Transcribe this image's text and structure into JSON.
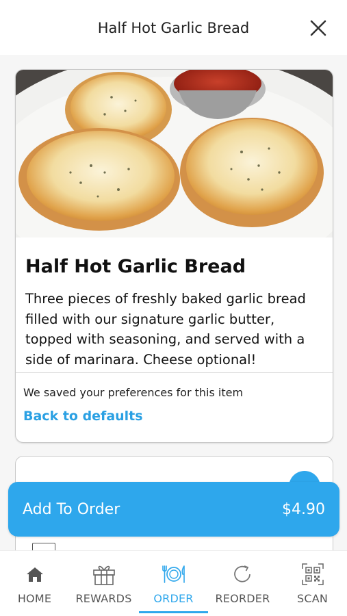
{
  "header": {
    "title": "Half Hot Garlic Bread",
    "close_icon": "close-icon"
  },
  "item": {
    "name": "Half Hot Garlic Bread",
    "description_lines": [
      "Three pieces of freshly baked garlic bread",
      "filled with our signature garlic butter,",
      "topped with seasoning, and served with a",
      "side of marinara. Cheese optional!"
    ],
    "preferences_note": "We saved your preferences for this item",
    "reset_link": "Back to defaults"
  },
  "cta": {
    "label": "Add To Order",
    "price": "$4.90"
  },
  "nav": {
    "items": [
      {
        "label": "HOME",
        "icon": "home-icon"
      },
      {
        "label": "REWARDS",
        "icon": "gift-icon"
      },
      {
        "label": "ORDER",
        "icon": "plate-utensils-icon",
        "active": true
      },
      {
        "label": "REORDER",
        "icon": "refresh-icon"
      },
      {
        "label": "SCAN",
        "icon": "qr-code-icon"
      }
    ]
  },
  "colors": {
    "accent": "#2ea7ec",
    "link": "#2aa0e3"
  }
}
